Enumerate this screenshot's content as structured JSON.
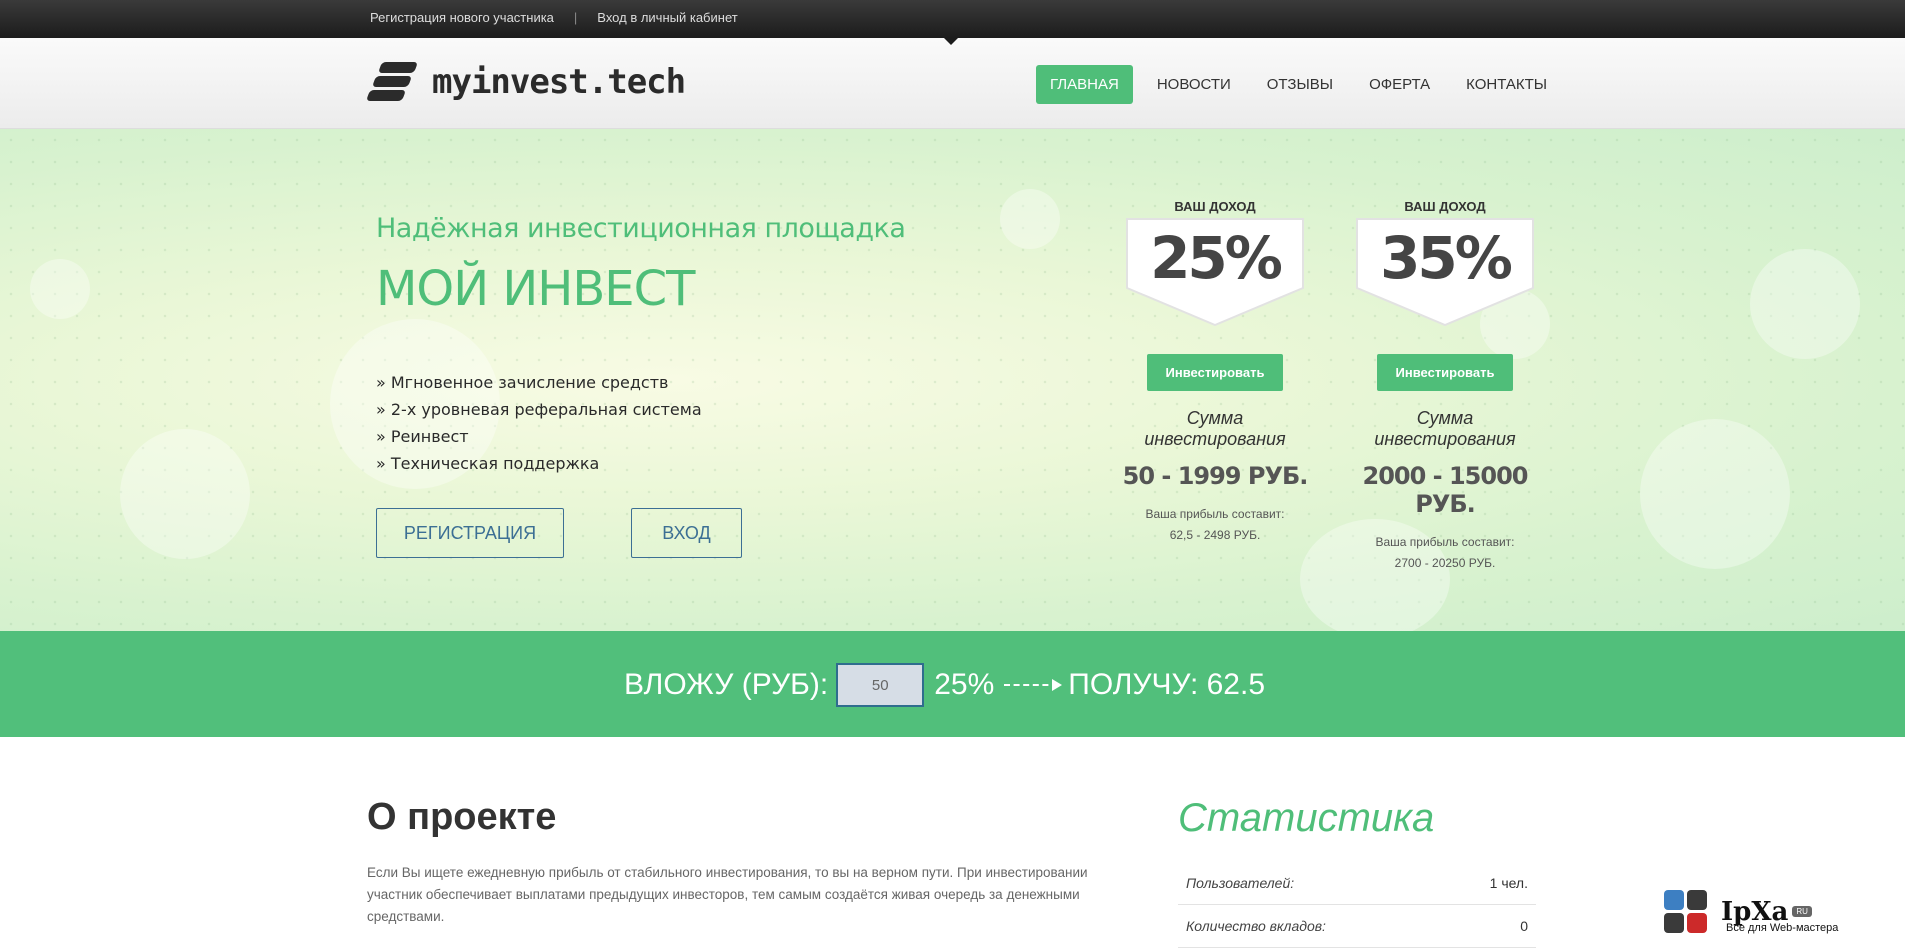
{
  "topbar": {
    "register_link": "Регистрация нового участника",
    "login_link": "Вход в личный кабинет",
    "separator": "|"
  },
  "header": {
    "logo_text": "myinvest.tech",
    "nav": [
      "ГЛАВНАЯ",
      "НОВОСТИ",
      "ОТЗЫВЫ",
      "ОФЕРТА",
      "КОНТАКТЫ"
    ],
    "active_nav": "ГЛАВНАЯ"
  },
  "hero": {
    "subtitle": "Надёжная инвестиционная площадка",
    "title": "МОЙ ИНВЕСТ",
    "features": [
      "» Мгновенное зачисление средств",
      "» 2-х уровневая реферальная система",
      "» Реинвест",
      "» Техническая поддержка"
    ],
    "register_button": "РЕГИСТРАЦИЯ",
    "login_button": "ВХОД"
  },
  "plans": [
    {
      "label": "ВАШ ДОХОД",
      "percent": "25%",
      "button": "Инвестировать",
      "sum_label": "Сумма инвестирования",
      "range": "50 - 1999 РУБ.",
      "profit_label": "Ваша прибыль составит:",
      "profit_value": "62,5 - 2498 РУБ."
    },
    {
      "label": "ВАШ ДОХОД",
      "percent": "35%",
      "button": "Инвестировать",
      "sum_label": "Сумма инвестирования",
      "range": "2000 - 15000 РУБ.",
      "profit_label": "Ваша прибыль составит:",
      "profit_value": "2700 - 20250 РУБ."
    }
  ],
  "calculator": {
    "invest_label": "ВЛОЖУ (РУБ):",
    "input_value": "50",
    "percent": "25%",
    "result_label": "ПОЛУЧУ: 62.5"
  },
  "about": {
    "title": "О проекте",
    "text": "Если Вы ищете ежедневную прибыль от стабильного инвестирования, то вы на верном пути. При инвестировании участник обеспечивает выплатами предыдущих инвесторов, тем самым создаётся живая очередь за денежными средствами."
  },
  "stats": {
    "title": "Статистика",
    "rows": [
      {
        "key": "Пользователей:",
        "value": "1 чел."
      },
      {
        "key": "Количество вкладов:",
        "value": "0"
      }
    ]
  },
  "watermark": {
    "brand": "IpXa",
    "badge": "RU",
    "tagline": "Все для Web-мастера"
  },
  "colors": {
    "accent": "#4fbe79",
    "topbar": "#1c1c1c",
    "outline_button": "#3c6f94"
  }
}
